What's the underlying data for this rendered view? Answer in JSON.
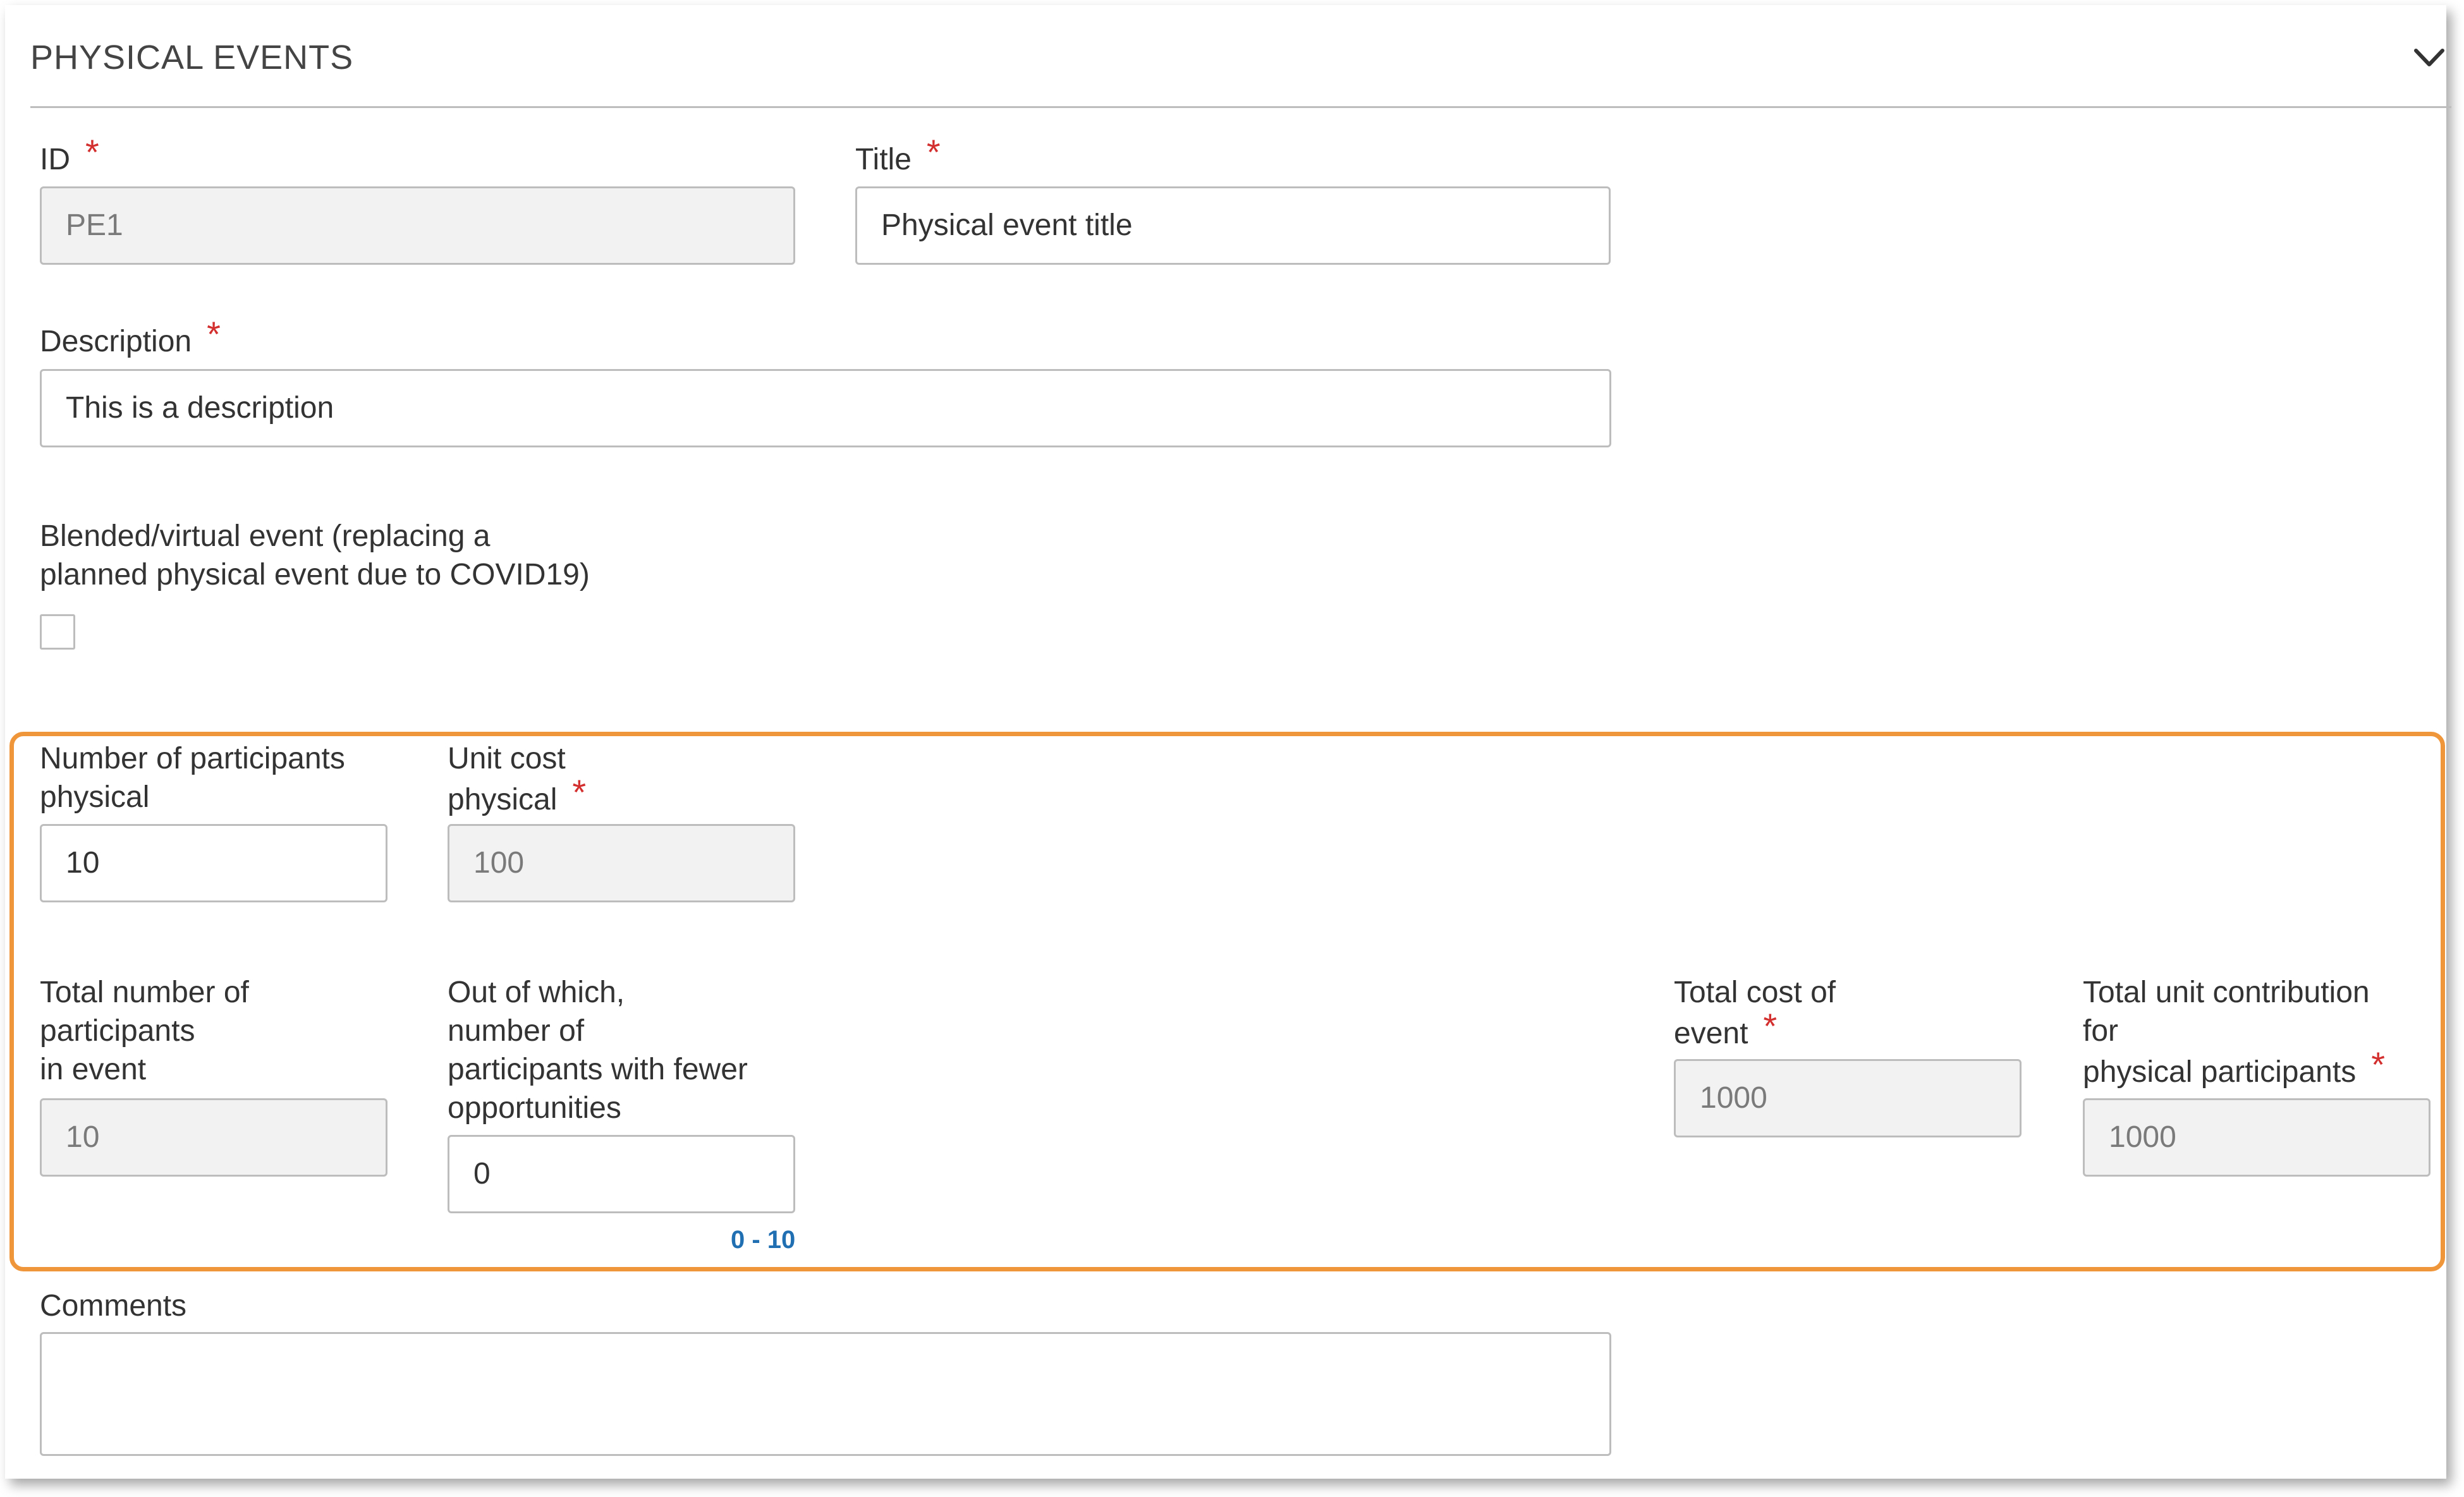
{
  "section": {
    "title": "PHYSICAL EVENTS"
  },
  "fields": {
    "id": {
      "label": "ID",
      "required_mark": "*",
      "value": "PE1"
    },
    "title": {
      "label": "Title",
      "required_mark": "*",
      "value": "Physical event title"
    },
    "description": {
      "label": "Description",
      "required_mark": "*",
      "value": "This is a description"
    },
    "blended": {
      "label_line1": "Blended/virtual event (replacing a",
      "label_line2": "planned physical event due to COVID19)",
      "checked": false
    },
    "participants_physical": {
      "label_line1": "Number of participants",
      "label_line2": "physical",
      "value": "10"
    },
    "unit_cost_physical": {
      "label_line1": "Unit cost",
      "label_line2": "physical",
      "required_mark": "*",
      "value": "100"
    },
    "total_participants": {
      "label_line1": "Total number of",
      "label_line2": "participants",
      "label_line3": "in event",
      "value": "10"
    },
    "fewer_opportunities": {
      "label_line1": "Out of which,",
      "label_line2": "number of",
      "label_line3": "participants with fewer",
      "label_line4": "opportunities",
      "value": "0",
      "range_hint": "0 - 10"
    },
    "total_cost": {
      "label_line1": "Total cost of",
      "label_line2": "event",
      "required_mark": "*",
      "value": "1000"
    },
    "total_unit_contribution": {
      "label_line1": "Total unit contribution",
      "label_line2": "for",
      "label_line3": "physical participants",
      "required_mark": "*",
      "value": "1000"
    },
    "comments": {
      "label": "Comments",
      "value": ""
    }
  },
  "colors": {
    "required": "#d32f2f",
    "highlight": "#f0963a",
    "hint": "#1f6fb2",
    "readonly_bg": "#f2f2f2"
  },
  "icons": {
    "collapse": "chevron-down-icon"
  }
}
